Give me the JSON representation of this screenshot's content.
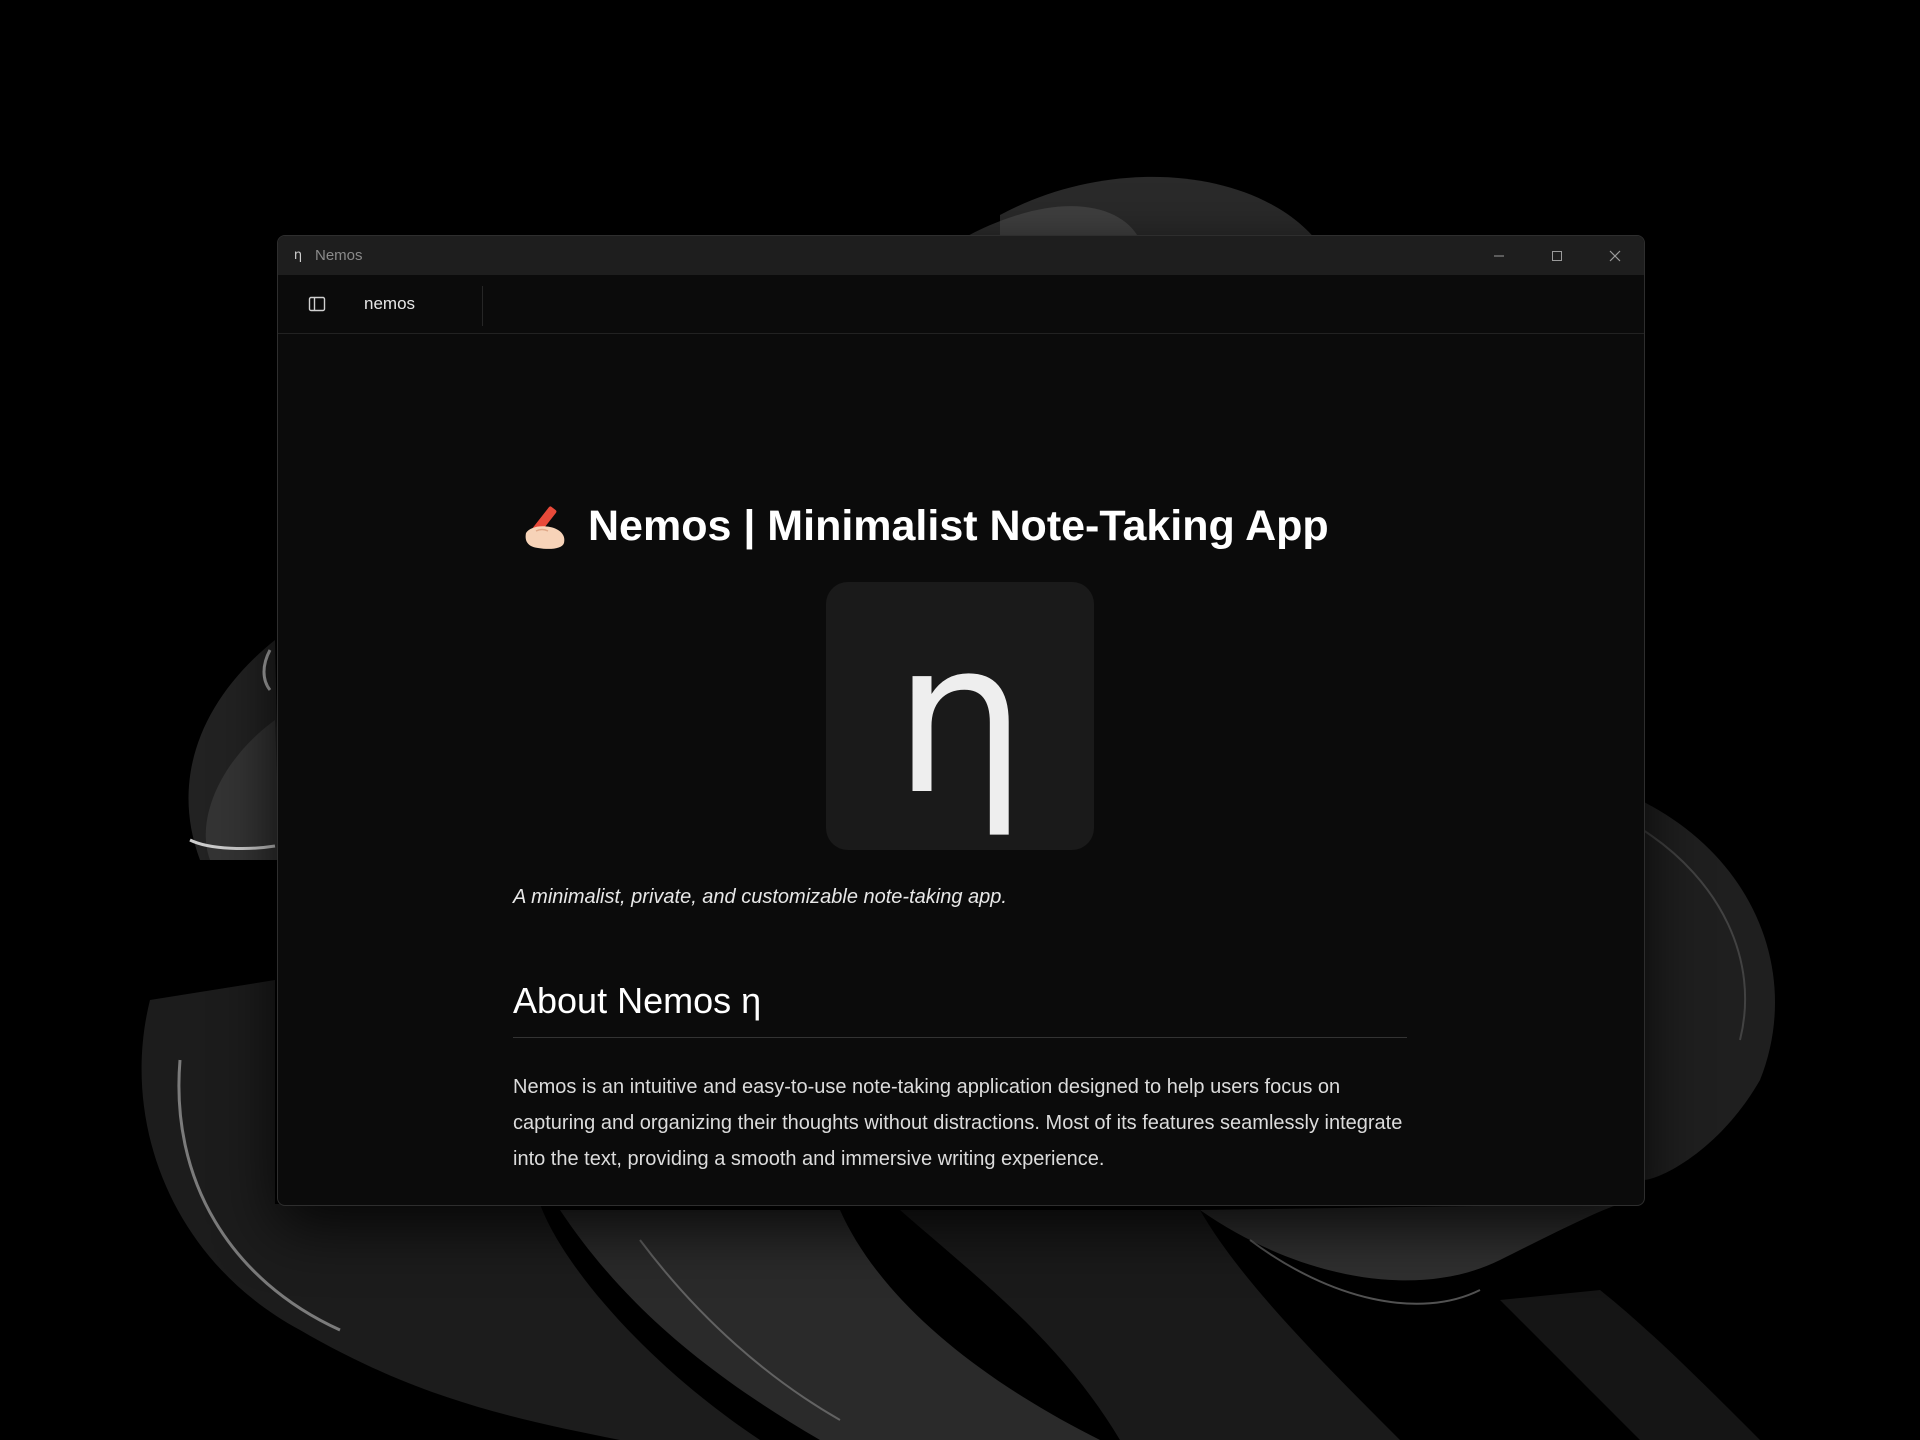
{
  "window": {
    "title": "Nemos",
    "app_icon": "η",
    "controls": [
      "minimize-icon",
      "maximize-icon",
      "close-icon"
    ]
  },
  "toolbar": {
    "sidebar_toggle_icon": "sidebar-icon",
    "tab_label": "nemos"
  },
  "document": {
    "title_emoji": "writing-hand-emoji",
    "title": "Nemos | Minimalist Note-Taking App",
    "logo_glyph": "η",
    "tagline": "A minimalist, private, and customizable note-taking app.",
    "section_heading": "About Nemos η",
    "paragraph": "Nemos is an intuitive and easy-to-use note-taking application designed to help users focus on capturing and organizing their thoughts without distractions. Most of its features seamlessly integrate into the text, providing a smooth and immersive writing experience."
  },
  "colors": {
    "desktop_bg": "#000000",
    "window_bg": "#0b0b0b",
    "titlebar_bg": "#1e1e1e",
    "logo_bg": "#1a1a1a",
    "text_primary": "#ffffff"
  }
}
